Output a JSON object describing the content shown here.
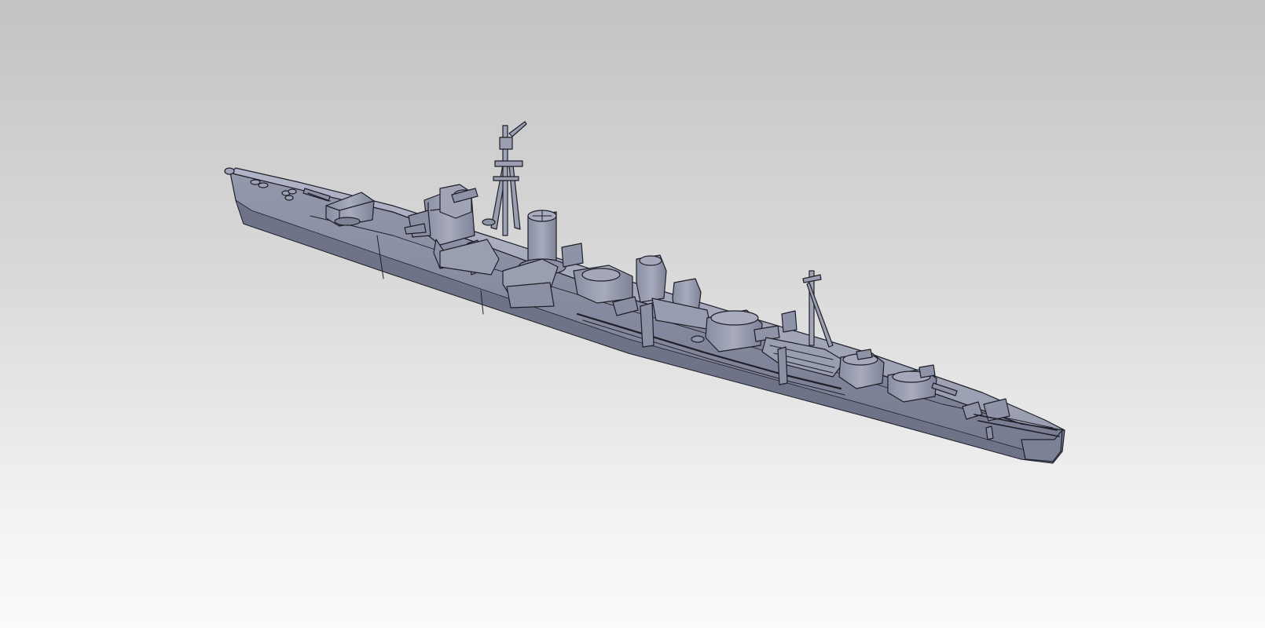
{
  "viewport": {
    "model": "destroyer-3d-model",
    "render_style": "shaded-with-edges",
    "background_top_color": "#c3c3c3",
    "background_bottom_color": "#fbfbfb",
    "hull_color": "#8b8fa3",
    "hull_shadow_color": "#6f7388",
    "deck_color": "#a2a6b8",
    "edge_color": "#1e1f28"
  }
}
